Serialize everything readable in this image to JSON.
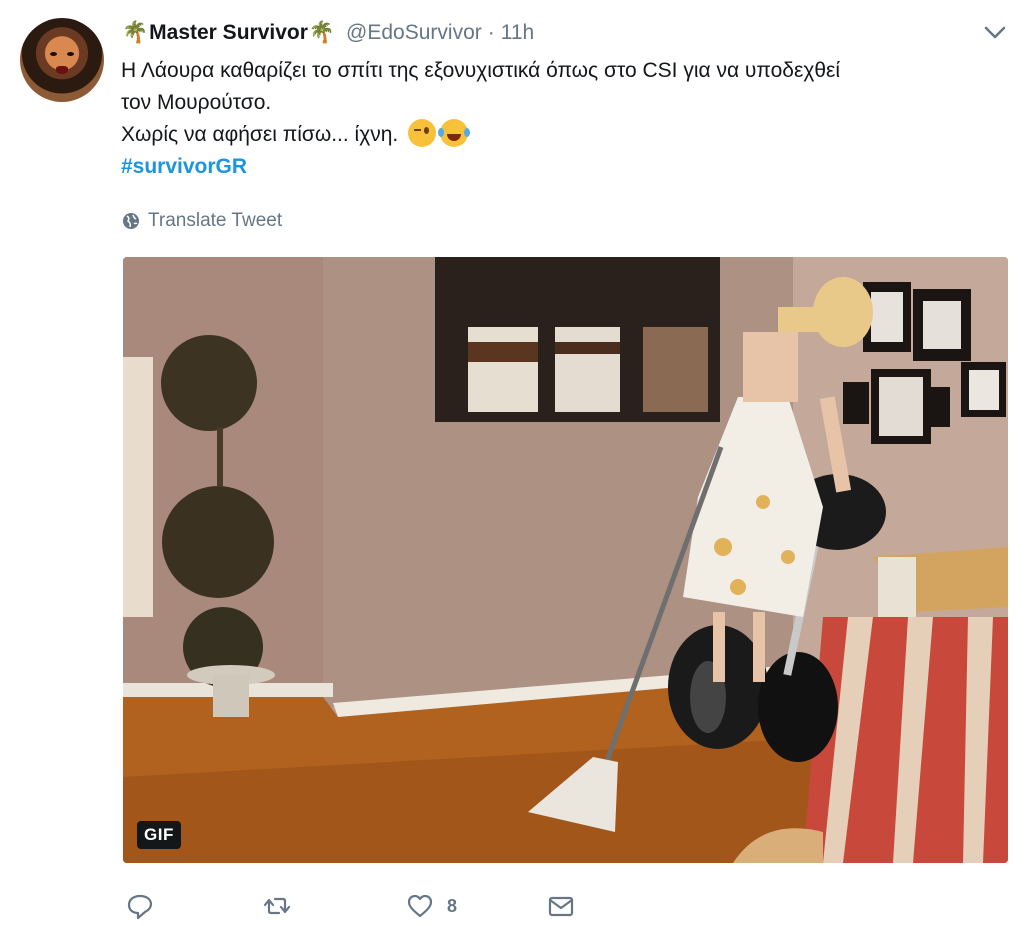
{
  "tweet": {
    "display_name": "Master Survivor",
    "name_emoji": "🌴",
    "handle": "@EdoSurvivor",
    "separator": "·",
    "time": "11h",
    "text_line1": "Η Λάουρα καθαρίζει το σπίτι της εξονυχιστικά όπως στο CSI για να υποδεχθεί",
    "text_line2": "τον Μουρούτσο.",
    "text_line3": "Χωρίς να αφήσει πίσω... ίχνη.",
    "emojis": [
      "winking-face",
      "face-with-tears-of-joy"
    ],
    "hashtag": "#survivorGR",
    "translate_label": "Translate Tweet",
    "media_badge": "GIF"
  },
  "actions": {
    "reply_count": "",
    "retweet_count": "",
    "like_count": "8",
    "message_count": ""
  },
  "colors": {
    "link": "#1b95e0",
    "secondary_text": "#657786",
    "primary_text": "#14171a"
  }
}
